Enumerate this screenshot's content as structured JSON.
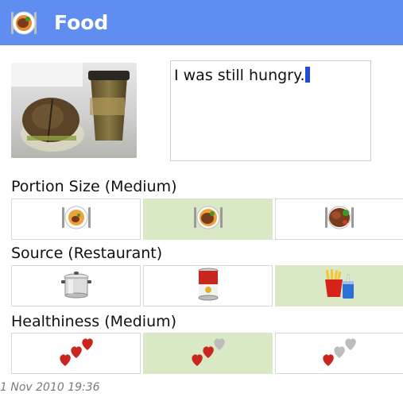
{
  "titlebar": {
    "title": "Food",
    "icon": "plate-with-food-icon",
    "bg_color": "#5f8ef0"
  },
  "photo": {
    "icon": "meal-photo-sandwich-and-coffee"
  },
  "note": {
    "text": "I was still hungry."
  },
  "portion": {
    "heading": "Portion Size (Medium)",
    "options": [
      {
        "icon": "small-portion-plate-icon",
        "selected": false
      },
      {
        "icon": "medium-portion-plate-icon",
        "selected": true
      },
      {
        "icon": "large-portion-plate-icon",
        "selected": false
      }
    ]
  },
  "source": {
    "heading": "Source (Restaurant)",
    "options": [
      {
        "icon": "cooking-pot-icon",
        "selected": false
      },
      {
        "icon": "canned-food-icon",
        "selected": false
      },
      {
        "icon": "fast-food-icon",
        "selected": true
      }
    ]
  },
  "healthiness": {
    "heading": "Healthiness (Medium)",
    "options": [
      {
        "icon": "three-red-hearts-icon",
        "selected": false
      },
      {
        "icon": "two-red-hearts-icon",
        "selected": true
      },
      {
        "icon": "one-red-heart-icon",
        "selected": false
      }
    ]
  },
  "colors": {
    "selected_bg": "#d9e9c6",
    "heart_red": "#c8261e",
    "heart_gray": "#bdbdbd"
  },
  "timestamp": "1 Nov 2010 19:36"
}
